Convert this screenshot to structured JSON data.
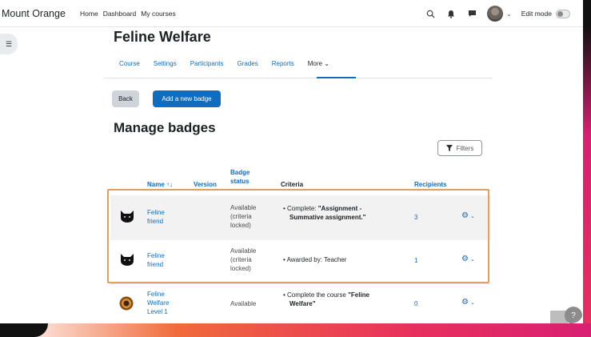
{
  "navbar": {
    "site_name": "Mount Orange",
    "links": [
      "Home",
      "Dashboard",
      "My courses"
    ],
    "edit_mode_label": "Edit mode"
  },
  "course": {
    "title": "Feline Welfare",
    "tabs": [
      "Course",
      "Settings",
      "Participants",
      "Grades",
      "Reports",
      "More ⌄"
    ]
  },
  "actions": {
    "back_label": "Back",
    "add_badge_label": "Add a new badge",
    "filters_label": "Filters"
  },
  "page": {
    "heading": "Manage badges"
  },
  "table": {
    "headers": {
      "name": "Name ↑↓",
      "version": "Version",
      "badge_status_1": "Badge",
      "badge_status_2": "status",
      "criteria": "Criteria",
      "recipients": "Recipients"
    },
    "rows": [
      {
        "name_1": "Feline",
        "name_2": "friend",
        "status_1": "Available",
        "status_2": "(criteria",
        "status_3": "locked)",
        "criteria_prefix": "Complete: ",
        "criteria_bold_1": "\"Assignment -",
        "criteria_bold_2": "Summative assignment.\"",
        "recipients": "3",
        "icon": "black-cat-icon"
      },
      {
        "name_1": "Feline",
        "name_2": "friend",
        "status_1": "Available",
        "status_2": "(criteria",
        "status_3": "locked)",
        "criteria": "Awarded by: Teacher",
        "recipients": "1",
        "icon": "black-cat-icon"
      },
      {
        "name_1": "Feline",
        "name_2": "Welfare",
        "name_3": "Level 1",
        "status_1": "Available",
        "criteria_prefix": "Complete the course ",
        "criteria_bold_1": "\"Feline",
        "criteria_bold_2": "Welfare\"",
        "recipients": "0",
        "icon": "medal-icon"
      }
    ]
  },
  "help": {
    "label": "?"
  },
  "colors": {
    "brand": "#0f6cbf",
    "highlight_border": "#e0a062",
    "row_shade": "#f2f2f2"
  }
}
